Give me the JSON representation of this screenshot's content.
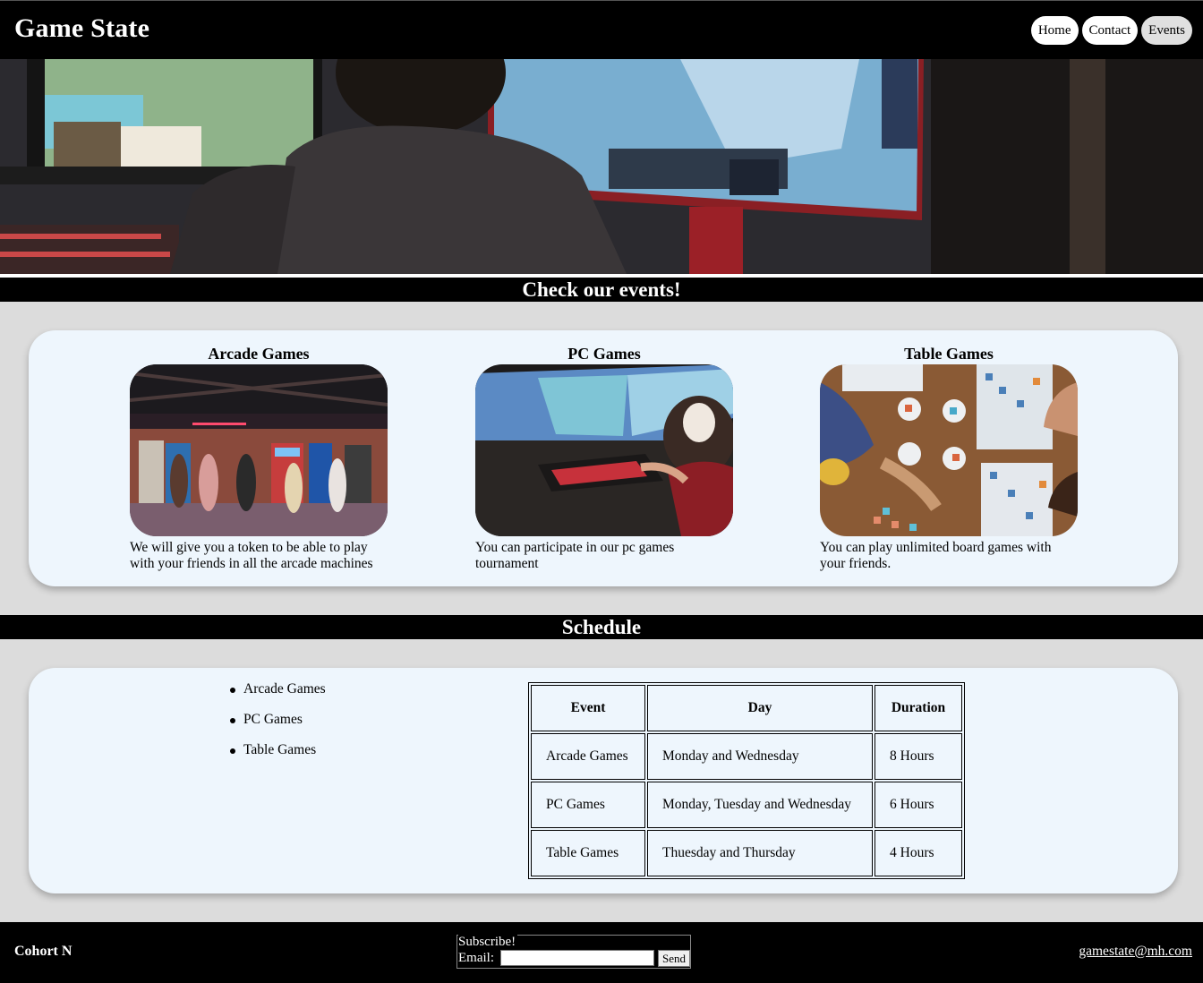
{
  "header": {
    "title": "Game State",
    "nav": [
      {
        "label": "Home"
      },
      {
        "label": "Contact"
      },
      {
        "label": "Events"
      }
    ]
  },
  "events_section": {
    "heading": "Check our events!",
    "events": [
      {
        "title": "Arcade Games",
        "description": "We will give you a token to be able to play with your friends in all the arcade machines"
      },
      {
        "title": "PC Games",
        "description": "You can participate in our pc games tournament"
      },
      {
        "title": "Table Games",
        "description": "You can play unlimited board games with your friends."
      }
    ]
  },
  "schedule_section": {
    "heading": "Schedule",
    "list": [
      "Arcade Games",
      "PC Games",
      "Table Games"
    ],
    "table": {
      "headers": [
        "Event",
        "Day",
        "Duration"
      ],
      "rows": [
        [
          "Arcade Games",
          "Monday and Wednesday",
          "8 Hours"
        ],
        [
          "PC Games",
          "Monday, Tuesday and Wednesday",
          "6 Hours"
        ],
        [
          "Table Games",
          "Thuesday and Thursday",
          "4 Hours"
        ]
      ]
    }
  },
  "footer": {
    "cohort": "Cohort N",
    "subscribe_legend": "Subscribe!",
    "email_label": "Email:",
    "email_value": "",
    "send_label": "Send",
    "contact_email": "gamestate@mh.com"
  },
  "colors": {
    "header_bg": "#000000",
    "page_bg": "#dcdcdc",
    "panel_bg": "#eef6fd",
    "nav_active": "#e0e0e0"
  }
}
